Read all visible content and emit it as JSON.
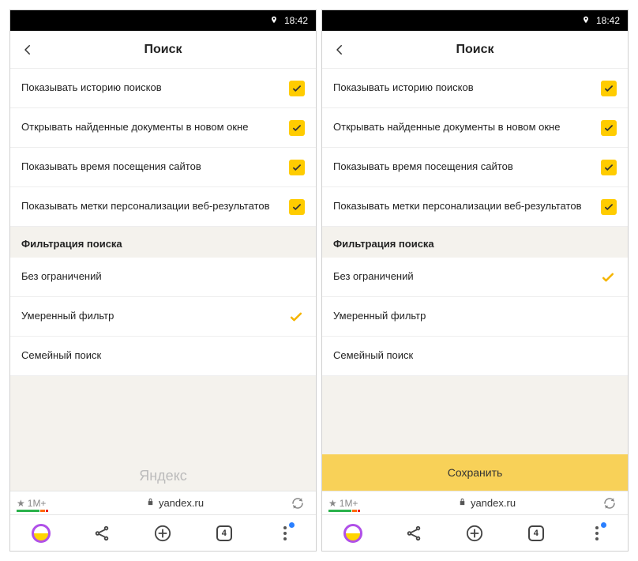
{
  "statusbar": {
    "time": "18:42"
  },
  "header": {
    "title": "Поиск"
  },
  "settings": [
    {
      "label": "Показывать историю поисков",
      "checked": true
    },
    {
      "label": "Открывать найденные документы в новом окне",
      "checked": true
    },
    {
      "label": "Показывать время посещения сайтов",
      "checked": true
    },
    {
      "label": "Показывать метки персонализации веб-результатов",
      "checked": true
    }
  ],
  "filter_section": {
    "title": "Фильтрация поиска"
  },
  "filters": [
    {
      "label": "Без ограничений"
    },
    {
      "label": "Умеренный фильтр"
    },
    {
      "label": "Семейный поиск"
    }
  ],
  "screens": [
    {
      "selected_filter_index": 1,
      "show_save": false,
      "logo": "Яндекс"
    },
    {
      "selected_filter_index": 0,
      "show_save": true
    }
  ],
  "save_button": {
    "label": "Сохранить"
  },
  "addressbar": {
    "rating": "1M+",
    "domain": "yandex.ru"
  },
  "tabs": {
    "count": "4"
  }
}
